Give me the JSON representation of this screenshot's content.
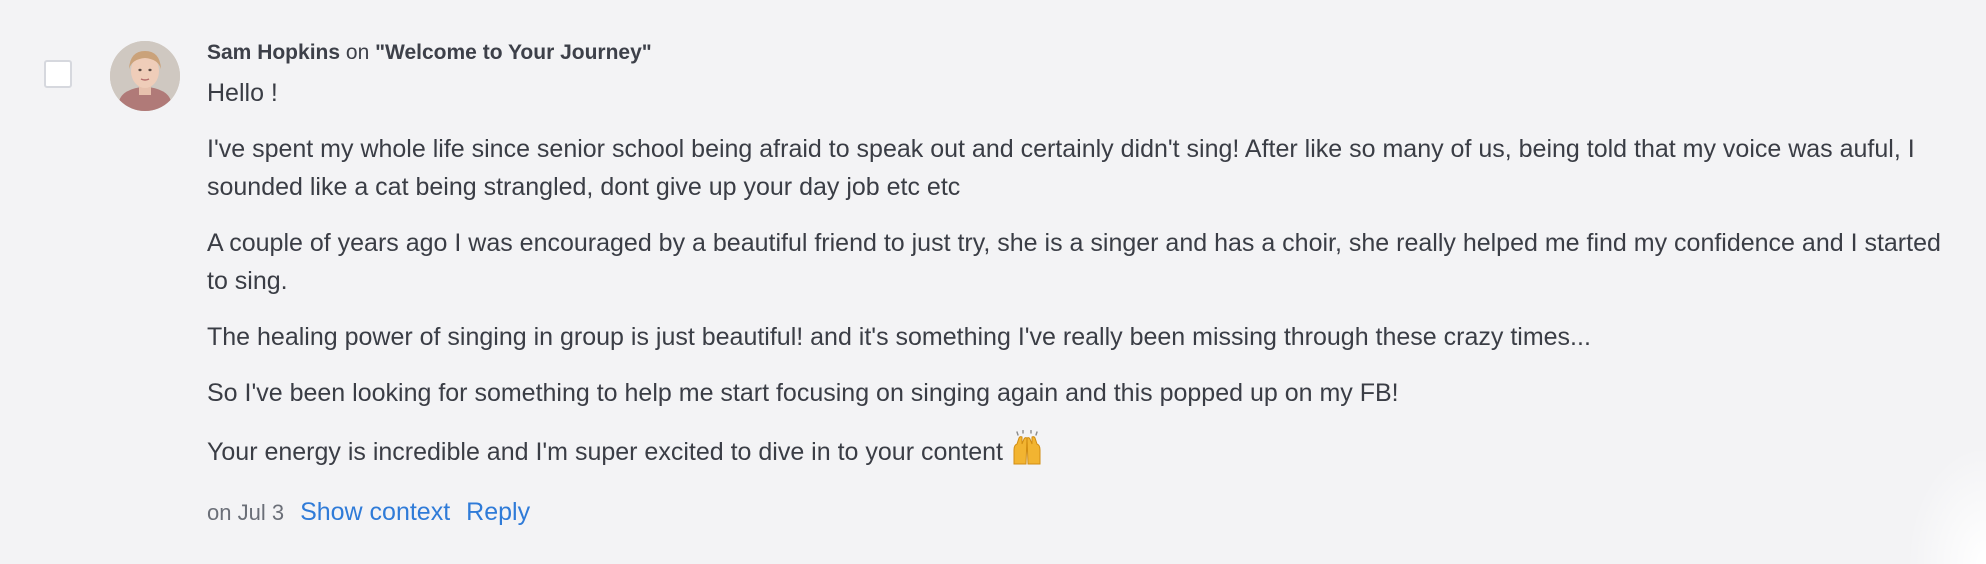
{
  "comment": {
    "author": "Sam Hopkins",
    "on_label": "on",
    "post_title_quoted": "\"Welcome to Your Journey\"",
    "paragraphs": [
      "Hello !",
      "I've spent my whole life since senior school being afraid to speak out and certainly didn't sing! After like so many of us, being told that my voice was auful, I sounded like a cat being strangled, dont give up your day job etc etc",
      "A couple of years ago I was encouraged by a beautiful friend to just try, she is a singer and has a choir, she really helped me find my confidence and I started to sing.",
      "The healing power of singing in group is just beautiful! and it's something I've really been missing through these crazy times...",
      "So I've been looking for something to help me start focusing on singing again and this popped up on my FB!",
      "Your energy is incredible and I'm super excited to dive in to your content"
    ],
    "emoji_name": "raising-hands-icon",
    "date": "on Jul 3",
    "show_context_label": "Show context",
    "reply_label": "Reply"
  },
  "colors": {
    "background": "#f3f3f5",
    "text": "#3a3d45",
    "link": "#2f7bd8",
    "muted": "#6b6f78"
  }
}
